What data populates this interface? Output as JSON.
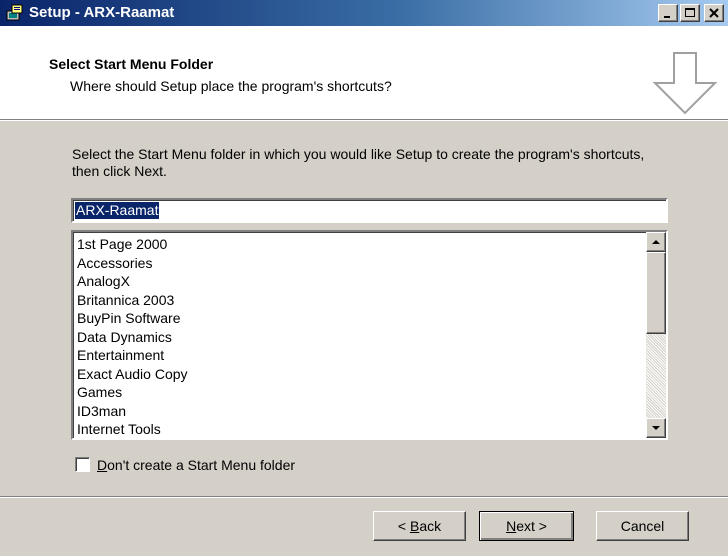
{
  "window": {
    "title": "Setup - ARX-Raamat"
  },
  "header": {
    "title": "Select Start Menu Folder",
    "subtitle": "Where should Setup place the program's shortcuts?"
  },
  "main": {
    "instruction": "Select the Start Menu folder in which you would like Setup to create the program's shortcuts, then click Next.",
    "folder_input_value": "ARX-Raamat",
    "folder_list": [
      "1st Page 2000",
      "Accessories",
      "AnalogX",
      "Britannica 2003",
      "BuyPin Software",
      "Data Dynamics",
      "Entertainment",
      "Exact Audio Copy",
      "Games",
      "ID3man",
      "Internet Tools"
    ],
    "checkbox": {
      "mnemonic": "D",
      "label_rest": "on't create a Start Menu folder",
      "checked": false
    }
  },
  "buttons": {
    "back_prefix": "< ",
    "back_mnemonic": "B",
    "back_rest": "ack",
    "next_mnemonic": "N",
    "next_rest": "ext >",
    "cancel": "Cancel"
  },
  "colors": {
    "titlebar_start": "#0a246a",
    "titlebar_end": "#a6caf0",
    "face": "#d4d0c8",
    "selection": "#0a246a"
  },
  "icons": [
    "setup-app-icon",
    "minimize-icon",
    "maximize-icon",
    "close-icon",
    "down-arrow-icon",
    "scroll-up-icon",
    "scroll-down-icon"
  ]
}
